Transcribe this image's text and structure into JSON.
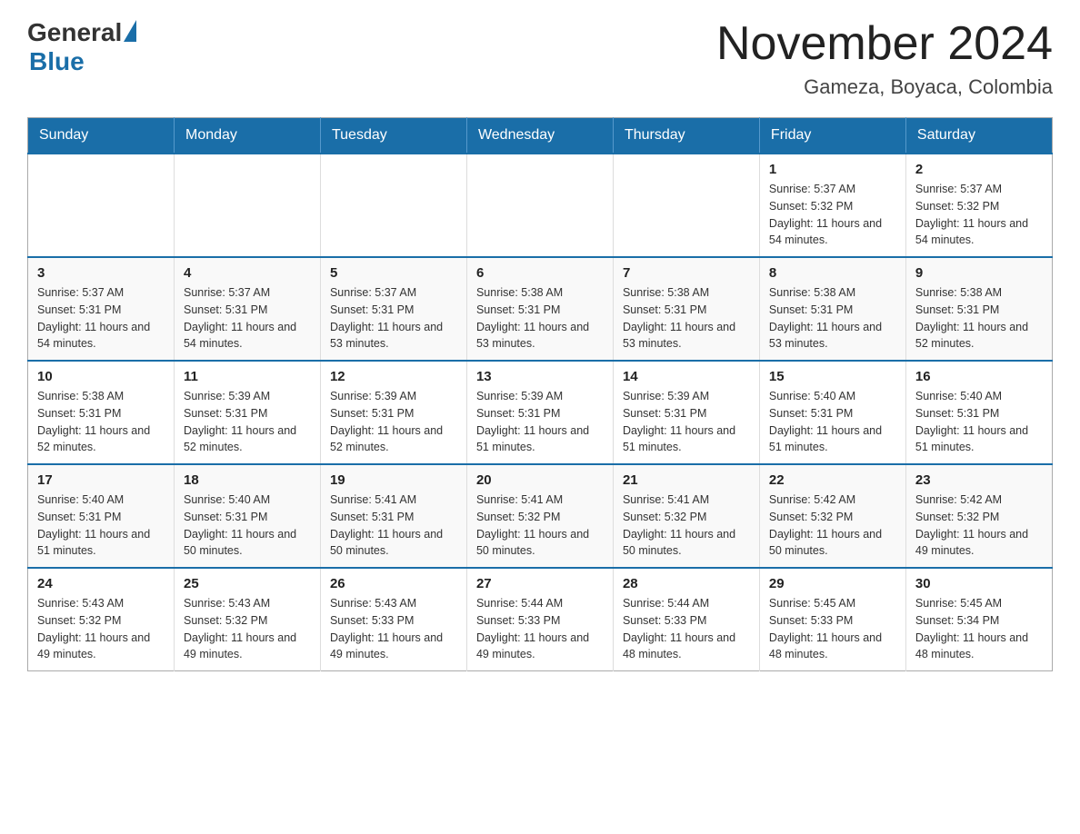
{
  "logo": {
    "general": "General",
    "blue": "Blue"
  },
  "title": "November 2024",
  "subtitle": "Gameza, Boyaca, Colombia",
  "weekdays": [
    "Sunday",
    "Monday",
    "Tuesday",
    "Wednesday",
    "Thursday",
    "Friday",
    "Saturday"
  ],
  "weeks": [
    [
      {
        "day": "",
        "info": ""
      },
      {
        "day": "",
        "info": ""
      },
      {
        "day": "",
        "info": ""
      },
      {
        "day": "",
        "info": ""
      },
      {
        "day": "",
        "info": ""
      },
      {
        "day": "1",
        "info": "Sunrise: 5:37 AM\nSunset: 5:32 PM\nDaylight: 11 hours and 54 minutes."
      },
      {
        "day": "2",
        "info": "Sunrise: 5:37 AM\nSunset: 5:32 PM\nDaylight: 11 hours and 54 minutes."
      }
    ],
    [
      {
        "day": "3",
        "info": "Sunrise: 5:37 AM\nSunset: 5:31 PM\nDaylight: 11 hours and 54 minutes."
      },
      {
        "day": "4",
        "info": "Sunrise: 5:37 AM\nSunset: 5:31 PM\nDaylight: 11 hours and 54 minutes."
      },
      {
        "day": "5",
        "info": "Sunrise: 5:37 AM\nSunset: 5:31 PM\nDaylight: 11 hours and 53 minutes."
      },
      {
        "day": "6",
        "info": "Sunrise: 5:38 AM\nSunset: 5:31 PM\nDaylight: 11 hours and 53 minutes."
      },
      {
        "day": "7",
        "info": "Sunrise: 5:38 AM\nSunset: 5:31 PM\nDaylight: 11 hours and 53 minutes."
      },
      {
        "day": "8",
        "info": "Sunrise: 5:38 AM\nSunset: 5:31 PM\nDaylight: 11 hours and 53 minutes."
      },
      {
        "day": "9",
        "info": "Sunrise: 5:38 AM\nSunset: 5:31 PM\nDaylight: 11 hours and 52 minutes."
      }
    ],
    [
      {
        "day": "10",
        "info": "Sunrise: 5:38 AM\nSunset: 5:31 PM\nDaylight: 11 hours and 52 minutes."
      },
      {
        "day": "11",
        "info": "Sunrise: 5:39 AM\nSunset: 5:31 PM\nDaylight: 11 hours and 52 minutes."
      },
      {
        "day": "12",
        "info": "Sunrise: 5:39 AM\nSunset: 5:31 PM\nDaylight: 11 hours and 52 minutes."
      },
      {
        "day": "13",
        "info": "Sunrise: 5:39 AM\nSunset: 5:31 PM\nDaylight: 11 hours and 51 minutes."
      },
      {
        "day": "14",
        "info": "Sunrise: 5:39 AM\nSunset: 5:31 PM\nDaylight: 11 hours and 51 minutes."
      },
      {
        "day": "15",
        "info": "Sunrise: 5:40 AM\nSunset: 5:31 PM\nDaylight: 11 hours and 51 minutes."
      },
      {
        "day": "16",
        "info": "Sunrise: 5:40 AM\nSunset: 5:31 PM\nDaylight: 11 hours and 51 minutes."
      }
    ],
    [
      {
        "day": "17",
        "info": "Sunrise: 5:40 AM\nSunset: 5:31 PM\nDaylight: 11 hours and 51 minutes."
      },
      {
        "day": "18",
        "info": "Sunrise: 5:40 AM\nSunset: 5:31 PM\nDaylight: 11 hours and 50 minutes."
      },
      {
        "day": "19",
        "info": "Sunrise: 5:41 AM\nSunset: 5:31 PM\nDaylight: 11 hours and 50 minutes."
      },
      {
        "day": "20",
        "info": "Sunrise: 5:41 AM\nSunset: 5:32 PM\nDaylight: 11 hours and 50 minutes."
      },
      {
        "day": "21",
        "info": "Sunrise: 5:41 AM\nSunset: 5:32 PM\nDaylight: 11 hours and 50 minutes."
      },
      {
        "day": "22",
        "info": "Sunrise: 5:42 AM\nSunset: 5:32 PM\nDaylight: 11 hours and 50 minutes."
      },
      {
        "day": "23",
        "info": "Sunrise: 5:42 AM\nSunset: 5:32 PM\nDaylight: 11 hours and 49 minutes."
      }
    ],
    [
      {
        "day": "24",
        "info": "Sunrise: 5:43 AM\nSunset: 5:32 PM\nDaylight: 11 hours and 49 minutes."
      },
      {
        "day": "25",
        "info": "Sunrise: 5:43 AM\nSunset: 5:32 PM\nDaylight: 11 hours and 49 minutes."
      },
      {
        "day": "26",
        "info": "Sunrise: 5:43 AM\nSunset: 5:33 PM\nDaylight: 11 hours and 49 minutes."
      },
      {
        "day": "27",
        "info": "Sunrise: 5:44 AM\nSunset: 5:33 PM\nDaylight: 11 hours and 49 minutes."
      },
      {
        "day": "28",
        "info": "Sunrise: 5:44 AM\nSunset: 5:33 PM\nDaylight: 11 hours and 48 minutes."
      },
      {
        "day": "29",
        "info": "Sunrise: 5:45 AM\nSunset: 5:33 PM\nDaylight: 11 hours and 48 minutes."
      },
      {
        "day": "30",
        "info": "Sunrise: 5:45 AM\nSunset: 5:34 PM\nDaylight: 11 hours and 48 minutes."
      }
    ]
  ]
}
